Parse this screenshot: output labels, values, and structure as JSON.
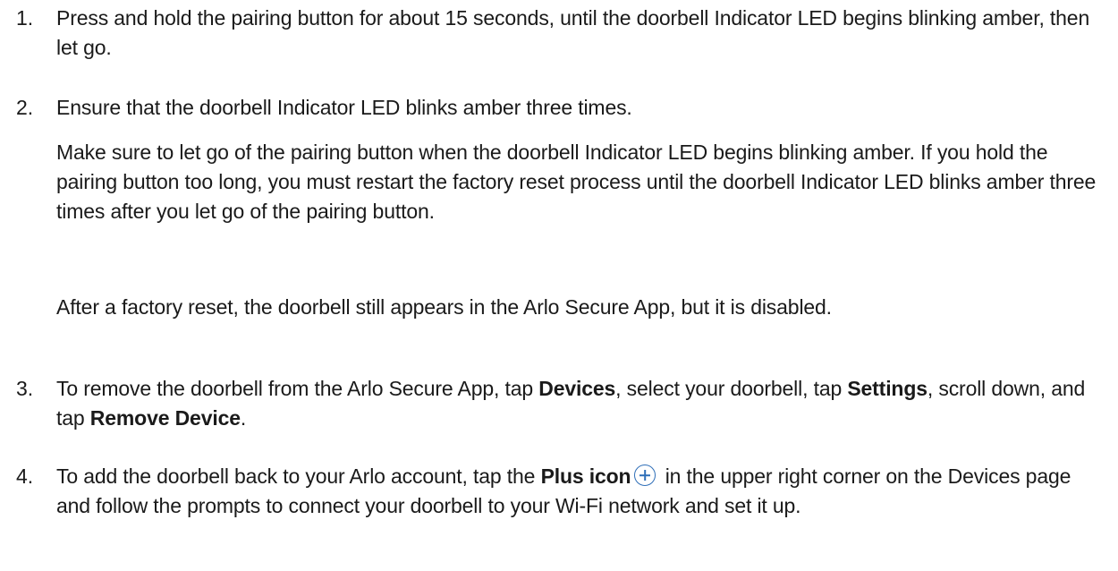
{
  "steps": [
    {
      "number": "1.",
      "text": "Press and hold the pairing button for about 15 seconds, until the doorbell Indicator LED begins blinking amber, then let go."
    },
    {
      "number": "2.",
      "text": "Ensure that the doorbell Indicator LED blinks amber three times.",
      "note1": "Make sure to let go of the pairing button when the doorbell Indicator LED begins blinking amber. If you hold the pairing button too long, you must restart the factory reset process until the doorbell Indicator LED blinks amber three times after you let go of the pairing button.",
      "note2": "After a factory reset, the doorbell still appears in the Arlo Secure App, but it is disabled."
    },
    {
      "number": "3.",
      "text_a": "To remove the doorbell from the Arlo Secure App, tap ",
      "bold_a": "Devices",
      "text_b": ", select your doorbell, tap ",
      "bold_b": "Settings",
      "text_c": ", scroll down, and tap ",
      "bold_c": "Remove Device",
      "text_d": "."
    },
    {
      "number": "4.",
      "text_a": "To add the doorbell back to  your Arlo account, tap the ",
      "bold_a": "Plus icon",
      "icon": "plus-circle-icon",
      "text_b": " in the upper right corner on the Devices page and follow the prompts to connect your doorbell to your Wi-Fi network and set it up."
    }
  ],
  "colors": {
    "text": "#1a1a1a",
    "icon": "#2f6fb8"
  }
}
